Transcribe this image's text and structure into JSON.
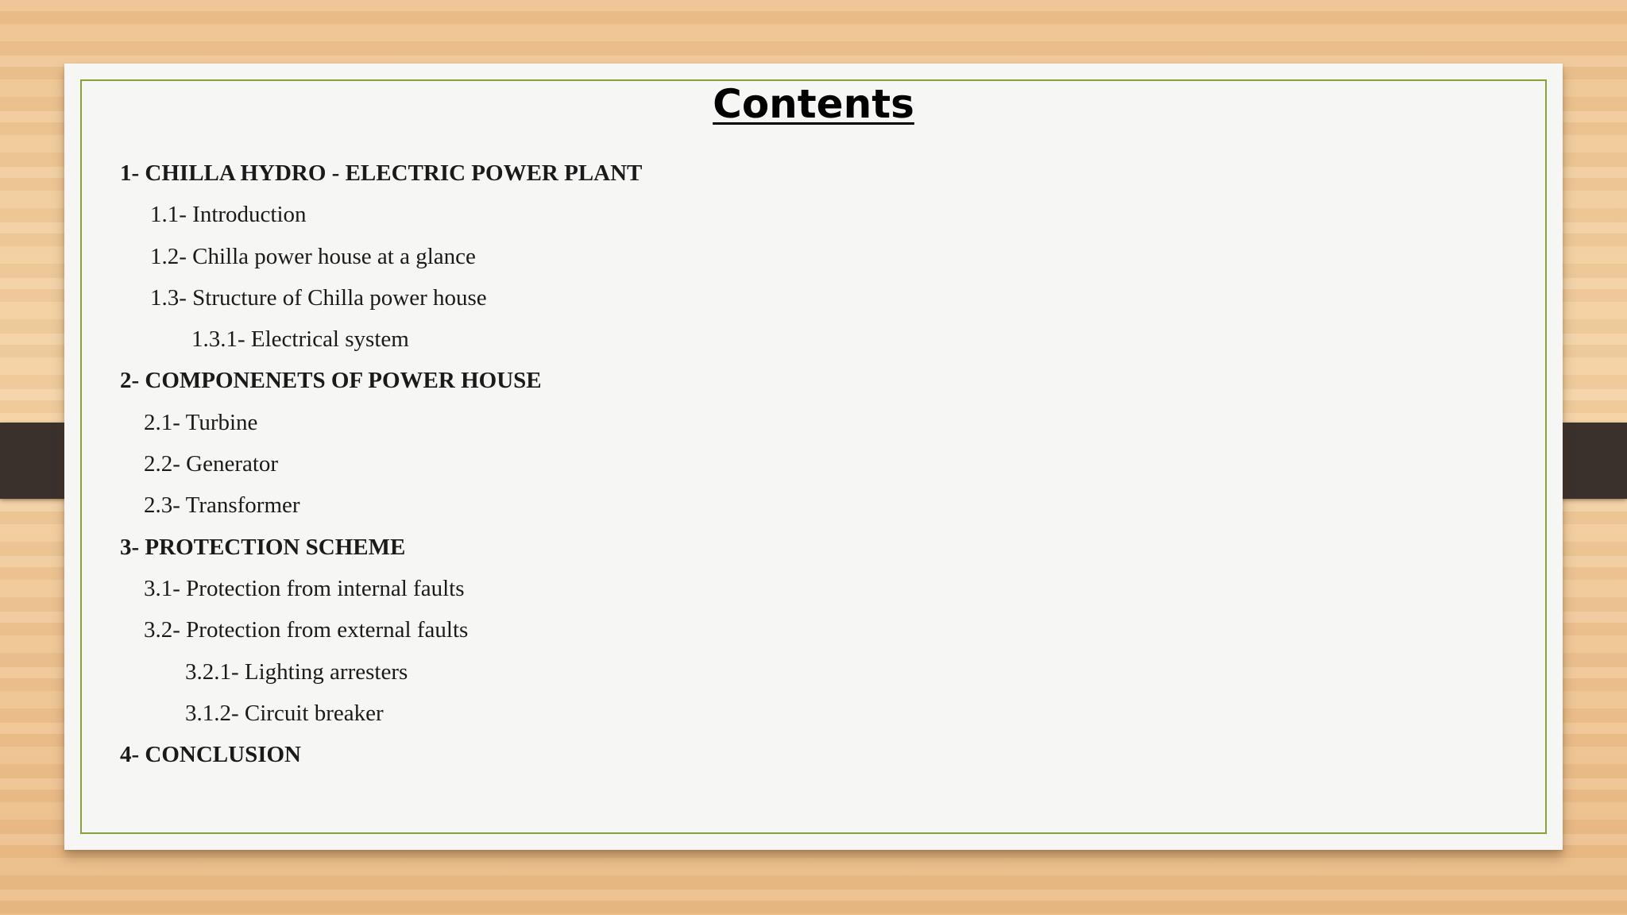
{
  "slide": {
    "title": "Contents",
    "items": [
      {
        "text": "1- CHILLA HYDRO - ELECTRIC POWER PLANT"
      },
      {
        "text": "1.1- Introduction"
      },
      {
        "text": "1.2- Chilla power house at a glance"
      },
      {
        "text": "1.3- Structure of Chilla power house"
      },
      {
        "text": "1.3.1- Electrical system"
      },
      {
        "text": "2- COMPONENETS OF POWER HOUSE"
      },
      {
        "text": "2.1- Turbine"
      },
      {
        "text": "2.2- Generator"
      },
      {
        "text": "2.3- Transformer"
      },
      {
        "text": "3- PROTECTION SCHEME"
      },
      {
        "text": "3.1- Protection from internal faults"
      },
      {
        "text": "3.2- Protection from external faults"
      },
      {
        "text": "3.2.1- Lighting arresters"
      },
      {
        "text": "3.1.2- Circuit breaker"
      },
      {
        "text": "4- CONCLUSION"
      }
    ]
  },
  "colors": {
    "frame_border": "#86a03a",
    "paper": "#f6f6f4",
    "background_wood": "#f1cc9b",
    "side_tabs": "#3a312c"
  }
}
